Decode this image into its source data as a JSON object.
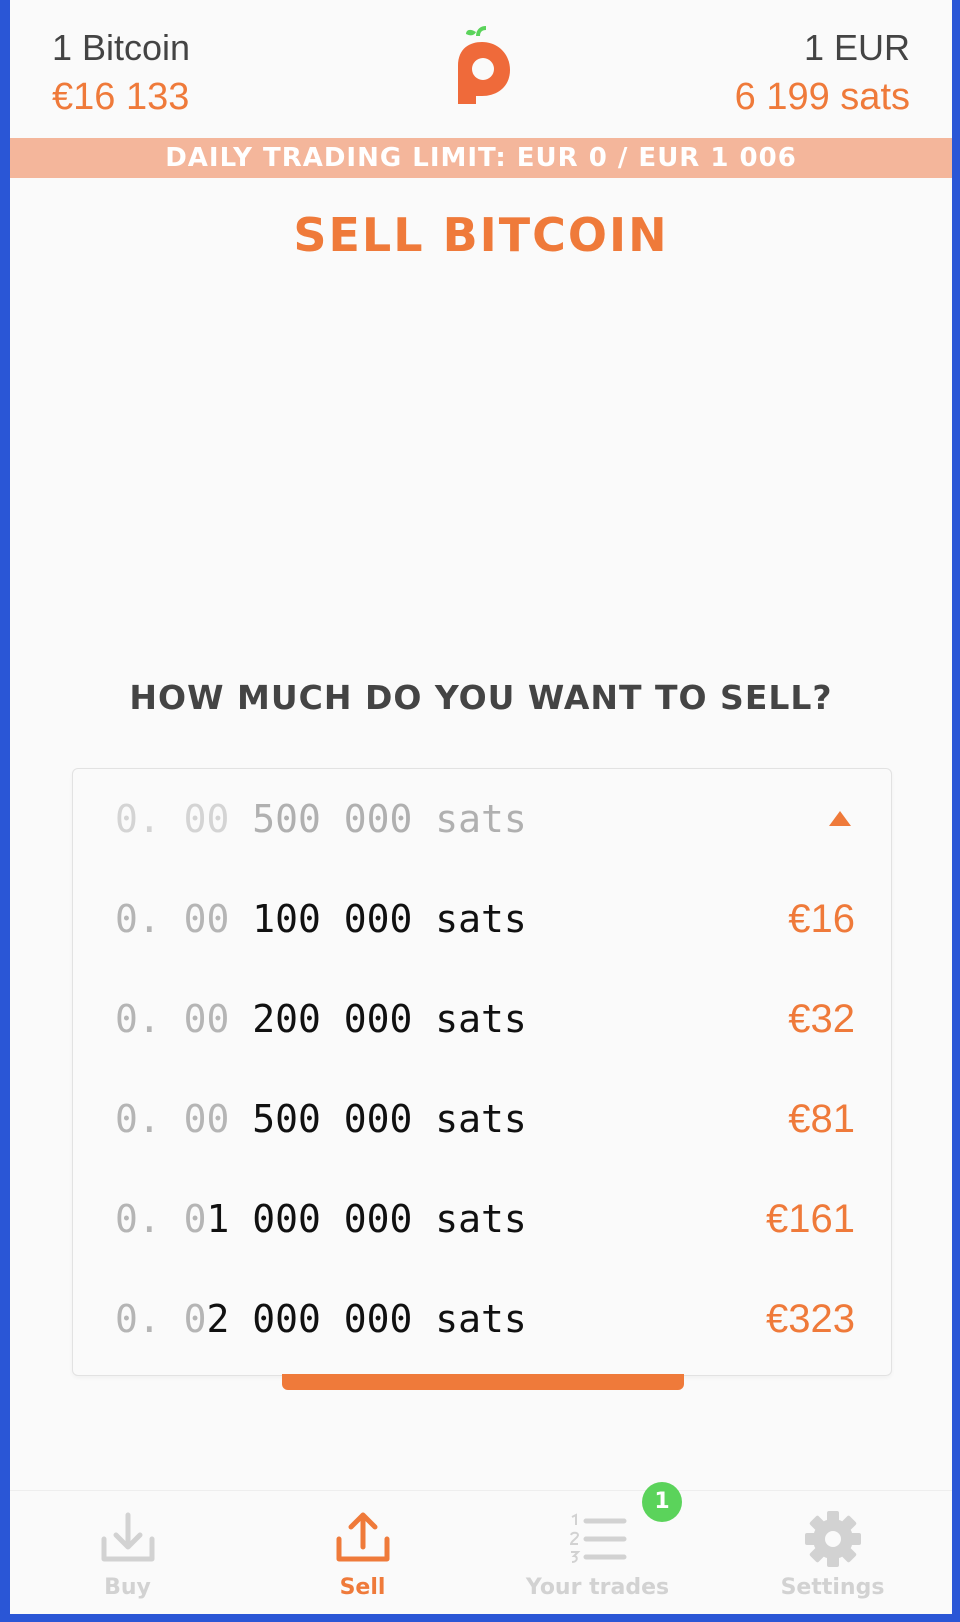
{
  "header": {
    "left_label": "1 Bitcoin",
    "left_value": "€16 133",
    "right_label": "1 EUR",
    "right_value": "6 199 sats",
    "logo_icon": "pocket-logo-icon"
  },
  "limit_bar": "DAILY TRADING LIMIT: EUR 0 / EUR 1 006",
  "title": "SELL BITCOIN",
  "question": "HOW MUCH DO YOU WANT TO SELL?",
  "amounts": {
    "selected": {
      "dim": "0. 00",
      "main": " 500 000 sats"
    },
    "options": [
      {
        "dim": "0. 00",
        "main": " 100 000 sats",
        "price": "€16"
      },
      {
        "dim": "0. 00",
        "main": " 200 000 sats",
        "price": "€32"
      },
      {
        "dim": "0. 00",
        "main": " 500 000 sats",
        "price": "€81"
      },
      {
        "dim": "0. 0",
        "main": "1 000 000 sats",
        "price": "€161"
      },
      {
        "dim": "0. 0",
        "main": "2 000 000 sats",
        "price": "€323"
      }
    ]
  },
  "nav": {
    "buy": "Buy",
    "sell": "Sell",
    "trades": "Your trades",
    "trades_badge": "1",
    "settings": "Settings"
  },
  "colors": {
    "accent": "#ef7a3a",
    "limit_bar": "#f4b69b",
    "badge": "#5bd35b",
    "inactive": "#d2d2d2"
  }
}
